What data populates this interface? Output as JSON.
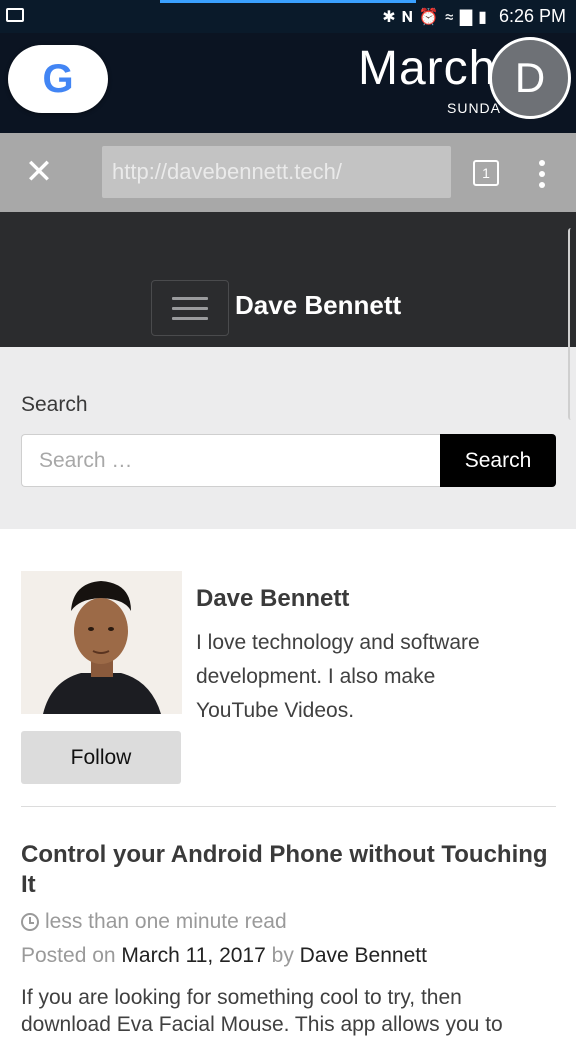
{
  "status_bar": {
    "time": "6:26 PM",
    "icons": [
      "gallery-icon",
      "bluetooth-icon",
      "nfc-icon",
      "alarm-icon",
      "wifi-icon",
      "signal-icon",
      "battery-icon"
    ]
  },
  "home_screen": {
    "google_letter": "G",
    "date_month": "March",
    "date_day": "SUNDA",
    "avatar_letter": "D"
  },
  "browser": {
    "url": "http://davebennett.tech/",
    "tab_count": "1"
  },
  "site": {
    "title": "Dave Bennett"
  },
  "search": {
    "label": "Search",
    "placeholder": "Search …",
    "button_label": "Search"
  },
  "profile": {
    "name": "Dave Bennett",
    "bio": "I love technology and software development. I also make YouTube Videos.",
    "follow_label": "Follow"
  },
  "post": {
    "title": "Control your Android Phone without Touching It",
    "read_time": "less than one minute read",
    "posted_on_label": "Posted on",
    "date": "March 11, 2017",
    "by_label": "by",
    "author": "Dave Bennett",
    "excerpt_line1": "If you are looking for something cool to try, then",
    "excerpt_line2": "download Eva Facial Mouse. This app allows you to"
  }
}
